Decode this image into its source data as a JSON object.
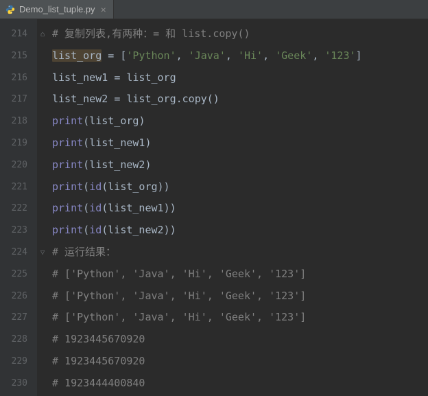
{
  "tab": {
    "filename": "Demo_list_tuple.py",
    "icon_name": "python-file-icon"
  },
  "gutter": {
    "start": 214,
    "end": 230
  },
  "folds": [
    {
      "line": 214,
      "glyph": "⌂"
    },
    {
      "line": 224,
      "glyph": "▽"
    }
  ],
  "code_lines": [
    {
      "n": 214,
      "tokens": [
        [
          "c-comment",
          "# 复制列表,有两种：= 和 list.copy()"
        ]
      ]
    },
    {
      "n": 215,
      "tokens": [
        [
          "highlight-var",
          "list_org"
        ],
        [
          "c-op",
          " = ["
        ],
        [
          "c-string",
          "'Python'"
        ],
        [
          "c-op",
          ", "
        ],
        [
          "c-string",
          "'Java'"
        ],
        [
          "c-op",
          ", "
        ],
        [
          "c-string",
          "'Hi'"
        ],
        [
          "c-op",
          ", "
        ],
        [
          "c-string",
          "'Geek'"
        ],
        [
          "c-op",
          ", "
        ],
        [
          "c-string",
          "'123'"
        ],
        [
          "c-op",
          "]"
        ]
      ]
    },
    {
      "n": 216,
      "tokens": [
        [
          "c-ident",
          "list_new1 "
        ],
        [
          "c-op",
          "= "
        ],
        [
          "c-ident",
          "list_org"
        ]
      ]
    },
    {
      "n": 217,
      "tokens": [
        [
          "c-ident",
          "list_new2 "
        ],
        [
          "c-op",
          "= "
        ],
        [
          "c-ident",
          "list_org.copy()"
        ]
      ]
    },
    {
      "n": 218,
      "tokens": [
        [
          "c-builtin",
          "print"
        ],
        [
          "c-op",
          "("
        ],
        [
          "c-ident",
          "list_org"
        ],
        [
          "c-op",
          ")"
        ]
      ]
    },
    {
      "n": 219,
      "tokens": [
        [
          "c-builtin",
          "print"
        ],
        [
          "c-op",
          "("
        ],
        [
          "c-ident",
          "list_new1"
        ],
        [
          "c-op",
          ")"
        ]
      ]
    },
    {
      "n": 220,
      "tokens": [
        [
          "c-builtin",
          "print"
        ],
        [
          "c-op",
          "("
        ],
        [
          "c-ident",
          "list_new2"
        ],
        [
          "c-op",
          ")"
        ]
      ]
    },
    {
      "n": 221,
      "tokens": [
        [
          "c-builtin",
          "print"
        ],
        [
          "c-op",
          "("
        ],
        [
          "c-builtin",
          "id"
        ],
        [
          "c-op",
          "("
        ],
        [
          "c-ident",
          "list_org"
        ],
        [
          "c-op",
          "))"
        ]
      ]
    },
    {
      "n": 222,
      "tokens": [
        [
          "c-builtin",
          "print"
        ],
        [
          "c-op",
          "("
        ],
        [
          "c-builtin",
          "id"
        ],
        [
          "c-op",
          "("
        ],
        [
          "c-ident",
          "list_new1"
        ],
        [
          "c-op",
          "))"
        ]
      ]
    },
    {
      "n": 223,
      "tokens": [
        [
          "c-builtin",
          "print"
        ],
        [
          "c-op",
          "("
        ],
        [
          "c-builtin",
          "id"
        ],
        [
          "c-op",
          "("
        ],
        [
          "c-ident",
          "list_new2"
        ],
        [
          "c-op",
          "))"
        ]
      ]
    },
    {
      "n": 224,
      "tokens": [
        [
          "c-comment",
          "# 运行结果："
        ]
      ]
    },
    {
      "n": 225,
      "tokens": [
        [
          "c-comment",
          "# ['Python', 'Java', 'Hi', 'Geek', '123']"
        ]
      ]
    },
    {
      "n": 226,
      "tokens": [
        [
          "c-comment",
          "# ['Python', 'Java', 'Hi', 'Geek', '123']"
        ]
      ]
    },
    {
      "n": 227,
      "tokens": [
        [
          "c-comment",
          "# ['Python', 'Java', 'Hi', 'Geek', '123']"
        ]
      ]
    },
    {
      "n": 228,
      "tokens": [
        [
          "c-comment",
          "# 1923445670920"
        ]
      ]
    },
    {
      "n": 229,
      "tokens": [
        [
          "c-comment",
          "# 1923445670920"
        ]
      ]
    },
    {
      "n": 230,
      "tokens": [
        [
          "c-comment",
          "# 1923444400840"
        ]
      ]
    }
  ]
}
